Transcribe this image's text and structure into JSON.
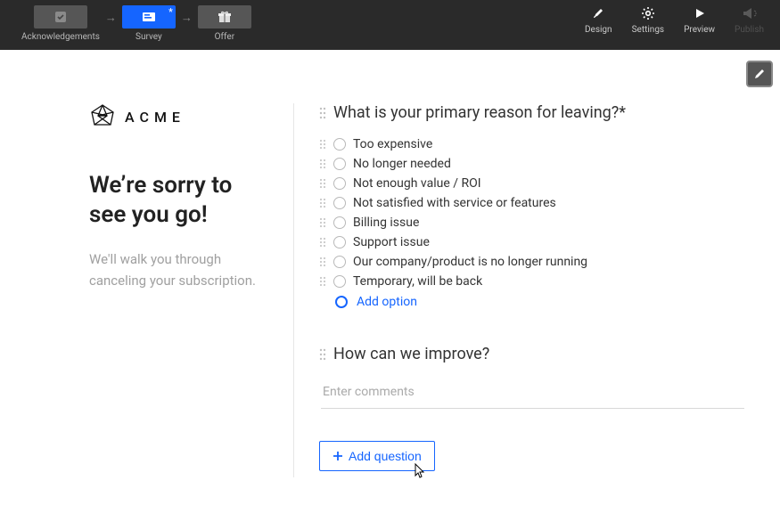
{
  "topbar": {
    "crumbs": [
      {
        "label": "Acknowledgements",
        "active": false
      },
      {
        "label": "Survey",
        "active": true
      },
      {
        "label": "Offer",
        "active": false
      }
    ],
    "tools": [
      {
        "label": "Design"
      },
      {
        "label": "Settings"
      },
      {
        "label": "Preview"
      },
      {
        "label": "Publish",
        "disabled": true
      }
    ]
  },
  "brand": {
    "name": "ACME"
  },
  "left": {
    "heading": "We’re sorry to see you go!",
    "subtext": "We'll walk you through canceling your subscription."
  },
  "survey": {
    "q1": {
      "title": "What is your primary reason for leaving?*",
      "options": [
        "Too expensive",
        "No longer needed",
        "Not enough value / ROI",
        "Not satisfied with service or features",
        "Billing issue",
        "Support issue",
        "Our company/product is no longer running",
        "Temporary, will be back"
      ],
      "add_option_label": "Add option"
    },
    "q2": {
      "title": "How can we improve?",
      "placeholder": "Enter comments"
    },
    "add_question_label": "Add question"
  }
}
